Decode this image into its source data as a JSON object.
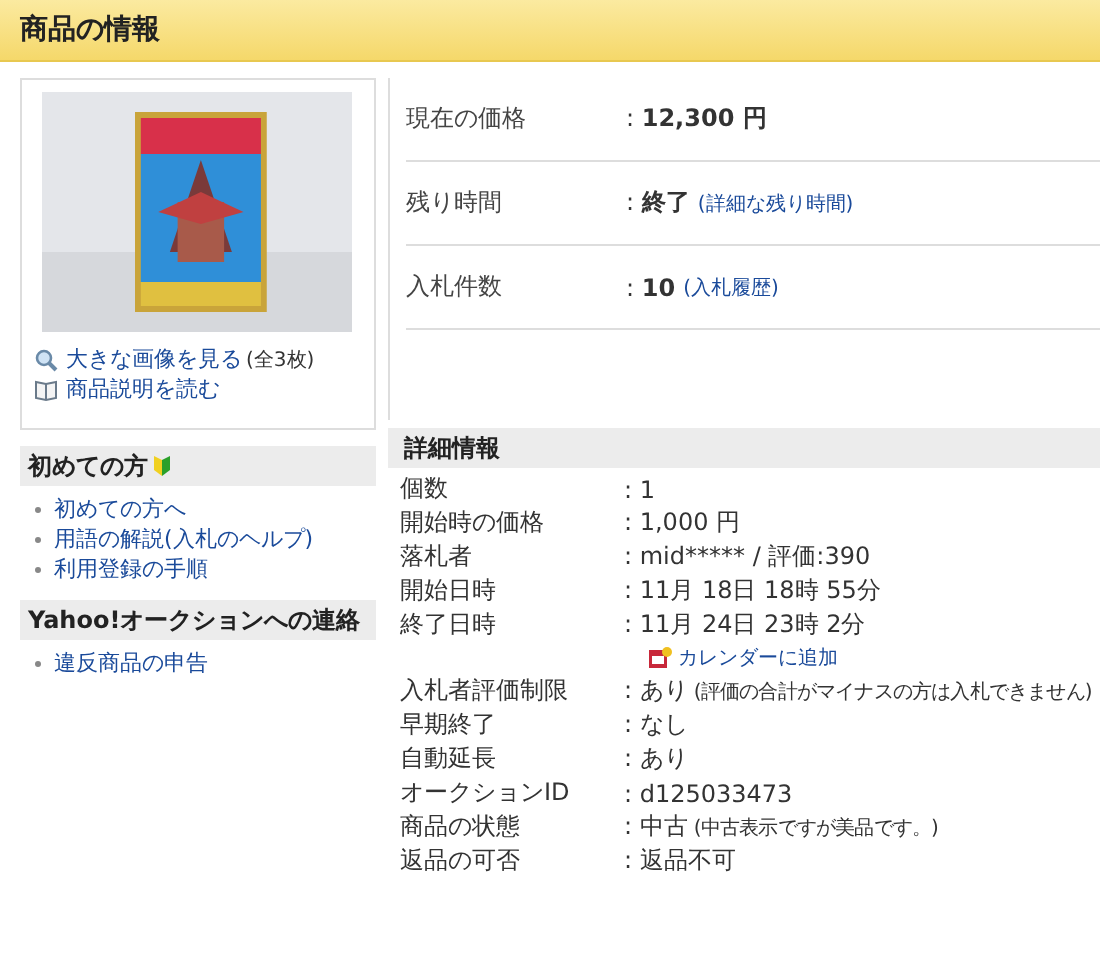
{
  "header": {
    "title": "商品の情報"
  },
  "image_card": {
    "links": [
      {
        "kind": "zoom",
        "text": "大きな画像を見る",
        "note": "(全3枚)"
      },
      {
        "kind": "book",
        "text": "商品説明を読む"
      }
    ]
  },
  "sections": [
    {
      "title": "初めての方",
      "badge": true,
      "items": [
        "初めての方へ",
        "用語の解説(入札のヘルプ)",
        "利用登録の手順"
      ]
    },
    {
      "title": "Yahoo!オークションへの連絡",
      "badge": false,
      "items": [
        "違反商品の申告"
      ]
    }
  ],
  "summary": [
    {
      "label": "現在の価格",
      "value": ": **12,300 円**"
    },
    {
      "label": "残り時間",
      "value": ": **終了**",
      "note": "(詳細な残り時間)",
      "note_link": true
    },
    {
      "label": "入札件数",
      "value": ": **10**",
      "note": "(入札履歴)",
      "note_link": true
    }
  ],
  "details": {
    "title": "詳細情報",
    "rows": [
      {
        "label": "個数",
        "value": ": 1"
      },
      {
        "label": "開始時の価格",
        "value": ": 1,000 円"
      },
      {
        "label": "落札者",
        "value": ": mid***** / 評価:390"
      },
      {
        "label": "開始日時",
        "value": ": 11月 18日 18時 55分"
      },
      {
        "label": "終了日時",
        "value": ": 11月 24日 23時 2分",
        "calendar_link": "カレンダーに追加"
      },
      {
        "label": "入札者評価制限",
        "value": ": あり",
        "note": "(評価の合計がマイナスの方は入札できません)",
        "note_link": false
      },
      {
        "label": "早期終了",
        "value": ": なし"
      },
      {
        "label": "自動延長",
        "value": ": あり"
      },
      {
        "label": "オークションID",
        "value": ": d125033473"
      },
      {
        "label": "商品の状態",
        "value": ": 中古",
        "note": "(中古表示ですが美品です。)",
        "note_link": false
      },
      {
        "label": "返品の可否",
        "value": ": 返品不可"
      }
    ]
  }
}
